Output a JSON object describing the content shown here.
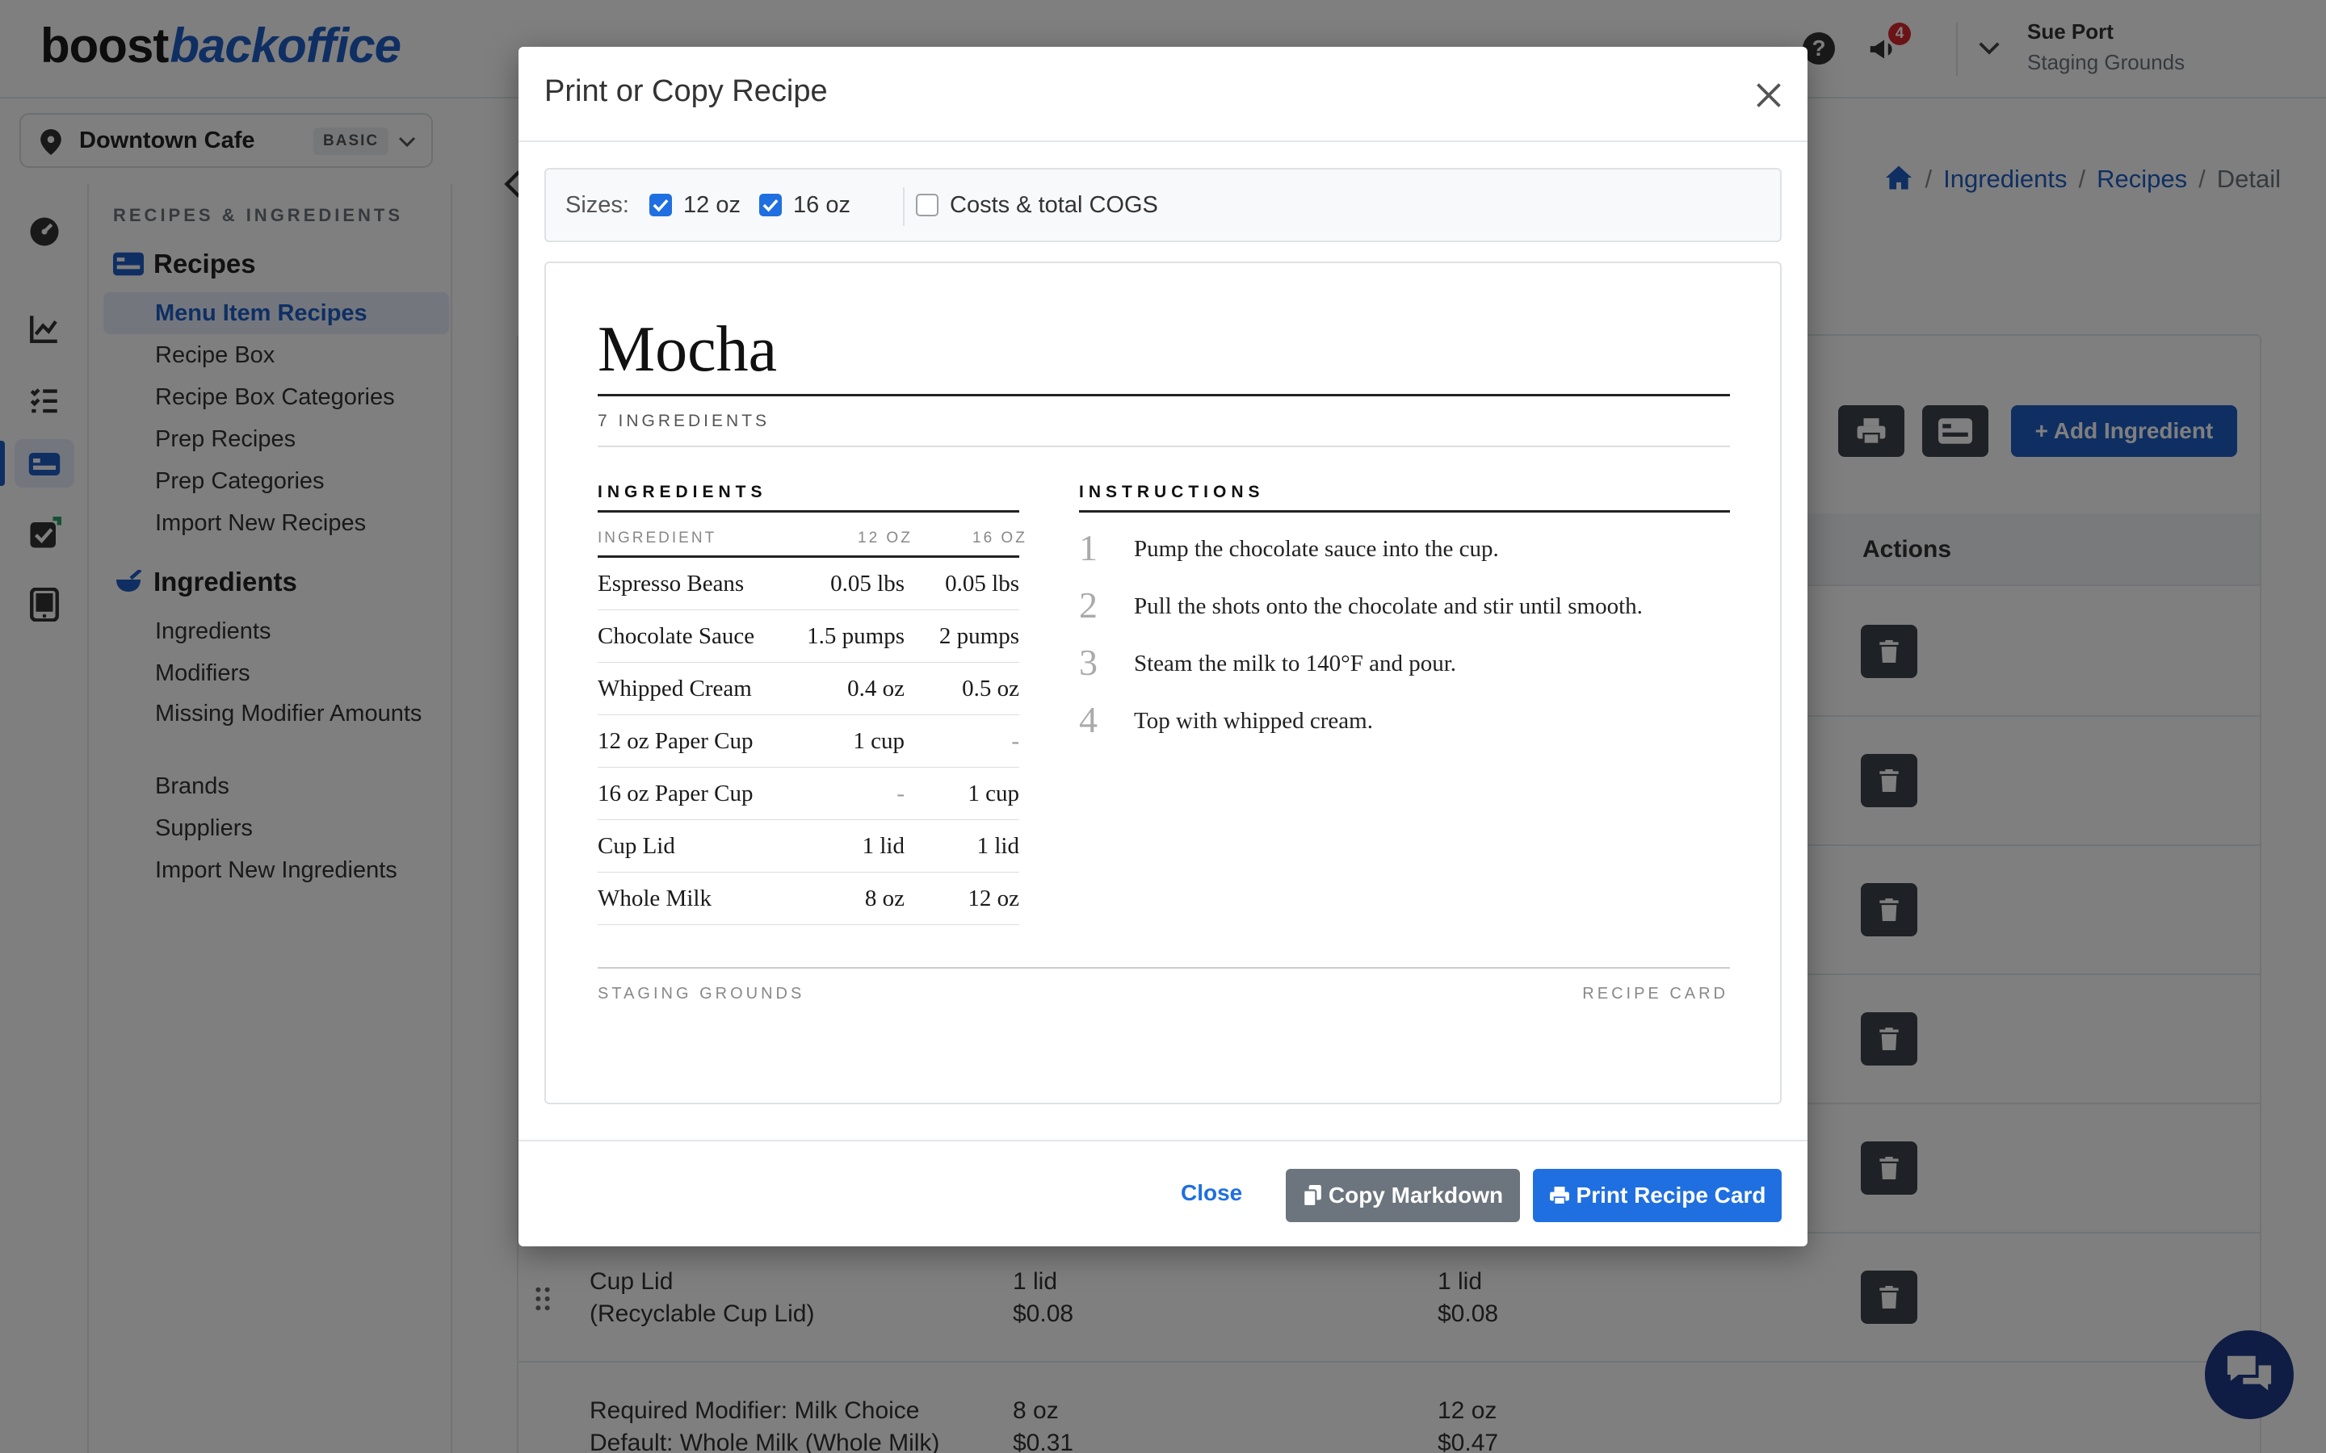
{
  "header": {
    "logo_a": "boost",
    "logo_b": "backoffice",
    "notification_count": "4",
    "user_name": "Sue Port",
    "org_name": "Staging Grounds"
  },
  "location": {
    "name": "Downtown Cafe",
    "plan": "BASIC"
  },
  "sidebar": {
    "section": "RECIPES & INGREDIENTS",
    "recipes_group": "Recipes",
    "recipes_items": [
      "Menu Item Recipes",
      "Recipe Box",
      "Recipe Box Categories",
      "Prep Recipes",
      "Prep Categories",
      "Import New Recipes"
    ],
    "ingredients_group": "Ingredients",
    "ingredients_items": [
      "Ingredients",
      "Modifiers",
      "Missing Modifier Amounts",
      "Brands",
      "Suppliers",
      "Import New Ingredients"
    ]
  },
  "breadcrumb": {
    "items": [
      "Ingredients",
      "Recipes",
      "Detail"
    ]
  },
  "main": {
    "add_button": "Add Ingredient",
    "actions_header": "Actions",
    "bg_rows": [
      {
        "name_l1": "Cup Lid",
        "name_l2": "(Recyclable Cup Lid)",
        "a1": "1 lid",
        "a2": "$0.08",
        "b1": "1 lid",
        "b2": "$0.08"
      },
      {
        "name_l1": "Required Modifier: Milk Choice",
        "name_l2": "Default: Whole Milk (Whole Milk)",
        "a1": "8 oz",
        "a2": "$0.31",
        "b1": "12 oz",
        "b2": "$0.47"
      }
    ]
  },
  "modal": {
    "title": "Print or Copy Recipe",
    "sizes_label": "Sizes:",
    "size_options": [
      {
        "label": "12 oz",
        "checked": true
      },
      {
        "label": "16 oz",
        "checked": true
      }
    ],
    "costs_option": {
      "label": "Costs & total COGS",
      "checked": false
    },
    "recipe": {
      "name": "Mocha",
      "count": "7 INGREDIENTS",
      "ingredients_heading": "INGREDIENTS",
      "instructions_heading": "INSTRUCTIONS",
      "columns": [
        "INGREDIENT",
        "12 OZ",
        "16 OZ"
      ],
      "rows": [
        [
          "Espresso Beans",
          "0.05 lbs",
          "0.05 lbs"
        ],
        [
          "Chocolate Sauce",
          "1.5 pumps",
          "2 pumps"
        ],
        [
          "Whipped Cream",
          "0.4 oz",
          "0.5 oz"
        ],
        [
          "12 oz Paper Cup",
          "1 cup",
          "-"
        ],
        [
          "16 oz Paper Cup",
          "-",
          "1 cup"
        ],
        [
          "Cup Lid",
          "1 lid",
          "1 lid"
        ],
        [
          "Whole Milk",
          "8 oz",
          "12 oz"
        ]
      ],
      "steps": [
        {
          "n": "1",
          "text": "Pump the chocolate sauce into the cup."
        },
        {
          "n": "2",
          "text": "Pull the shots onto the chocolate and stir until smooth."
        },
        {
          "n": "3",
          "text": "Steam the milk to 140°F and pour."
        },
        {
          "n": "4",
          "text": "Top with whipped cream."
        }
      ],
      "footer_left": "STAGING GROUNDS",
      "footer_right": "RECIPE CARD"
    },
    "close_label": "Close",
    "copy_label": "Copy Markdown",
    "print_label": "Print Recipe Card"
  },
  "colors": {
    "primary": "#1f6fe0",
    "brand": "#1f5fc7",
    "dark_button": "#3d434a",
    "secondary": "#6c757d"
  }
}
